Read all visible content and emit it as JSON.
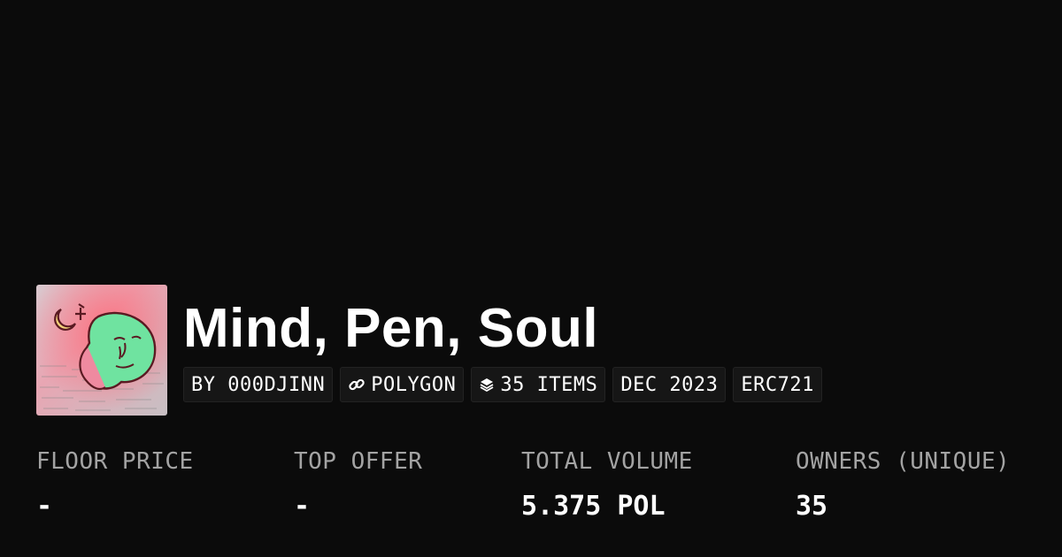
{
  "collection": {
    "name": "Mind, Pen, Soul",
    "thumbnail_icon": "collection-artwork-face"
  },
  "tags": [
    {
      "label": "BY 000DJINN",
      "icon": ""
    },
    {
      "label": "POLYGON",
      "icon": "chain-link-icon"
    },
    {
      "label": "35 ITEMS",
      "icon": "layers-icon"
    },
    {
      "label": "DEC 2023",
      "icon": ""
    },
    {
      "label": "ERC721",
      "icon": ""
    }
  ],
  "stats": [
    {
      "label": "FLOOR PRICE",
      "value": "-"
    },
    {
      "label": "TOP OFFER",
      "value": "-"
    },
    {
      "label": "TOTAL VOLUME",
      "value": "5.375 POL"
    },
    {
      "label": "OWNERS (UNIQUE)",
      "value": "35"
    }
  ],
  "colors": {
    "background": "#0b0b0b",
    "tag_background": "#161616",
    "label_gray": "#a3a3a3",
    "text": "#ffffff"
  }
}
